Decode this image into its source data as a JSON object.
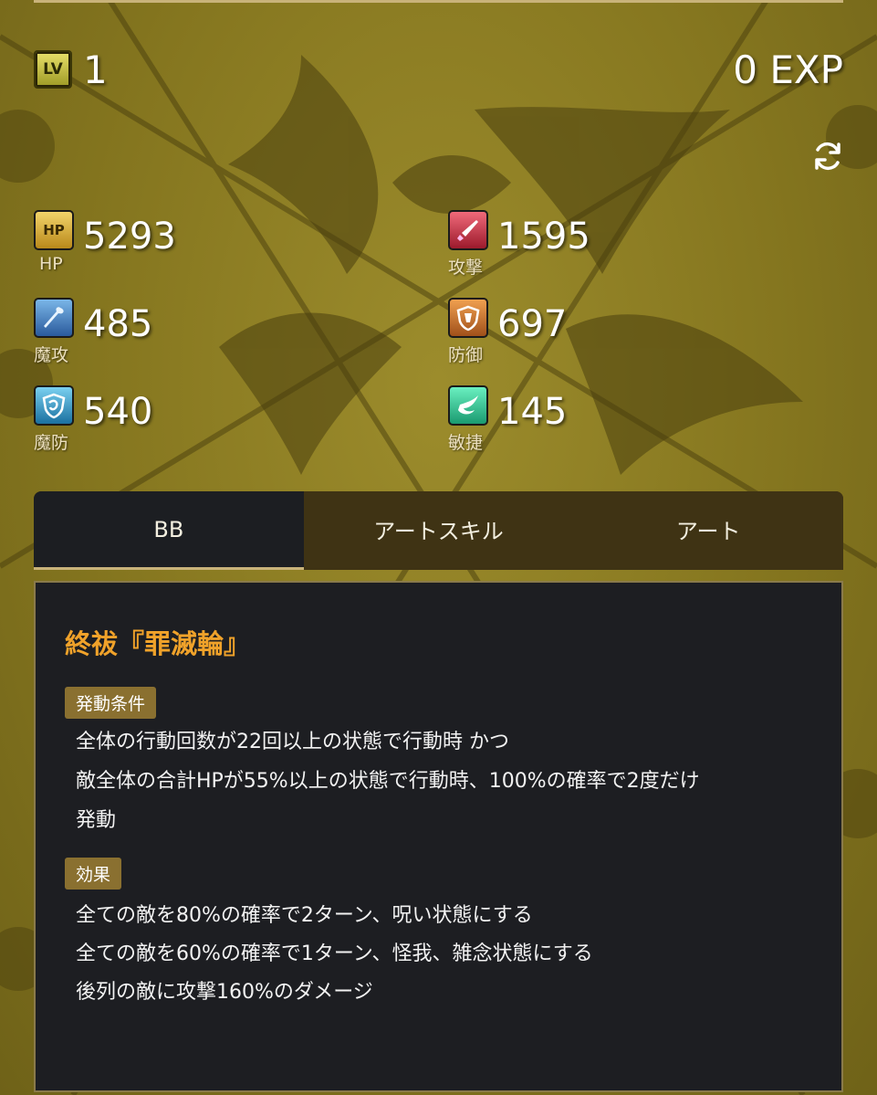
{
  "header": {
    "level_icon": "LV",
    "level": "1",
    "exp": "0 EXP",
    "refresh_icon": "refresh-icon"
  },
  "stats": [
    {
      "key": "hp",
      "icon": "hp-icon",
      "icon_text": "HP",
      "label": "HP",
      "value": "5293",
      "color": "#e2b33a"
    },
    {
      "key": "atk",
      "icon": "sword-icon",
      "icon_text": "",
      "label": "攻撃",
      "value": "1595",
      "color": "#d13a50"
    },
    {
      "key": "matk",
      "icon": "staff-icon",
      "icon_text": "",
      "label": "魔攻",
      "value": "485",
      "color": "#3a7ac0"
    },
    {
      "key": "def",
      "icon": "shield-icon",
      "icon_text": "",
      "label": "防御",
      "value": "697",
      "color": "#d0702a"
    },
    {
      "key": "mdef",
      "icon": "magic-shield-icon",
      "icon_text": "",
      "label": "魔防",
      "value": "540",
      "color": "#2a90c0"
    },
    {
      "key": "spd",
      "icon": "wing-icon",
      "icon_text": "",
      "label": "敏捷",
      "value": "145",
      "color": "#2ab08a"
    }
  ],
  "tabs": [
    {
      "label": "BB",
      "active": true
    },
    {
      "label": "アートスキル",
      "active": false
    },
    {
      "label": "アート",
      "active": false
    }
  ],
  "skill": {
    "name": "終祓『罪滅輪』",
    "condition_label": "発動条件",
    "condition_lines": [
      "全体の行動回数が22回以上の状態で行動時 かつ",
      "敵全体の合計HPが55%以上の状態で行動時、100%の確率で2度だけ",
      "発動"
    ],
    "effect_label": "効果",
    "effect_lines": [
      "全ての敵を80%の確率で2ターン、呪い状態にする",
      "全ての敵を60%の確率で1ターン、怪我、雑念状態にする",
      "後列の敵に攻撃160%のダメージ"
    ]
  },
  "colors": {
    "accent": "#f0a22a",
    "panel": "#1d1e22",
    "tag": "#8a7030",
    "background": "#8a7a22"
  }
}
